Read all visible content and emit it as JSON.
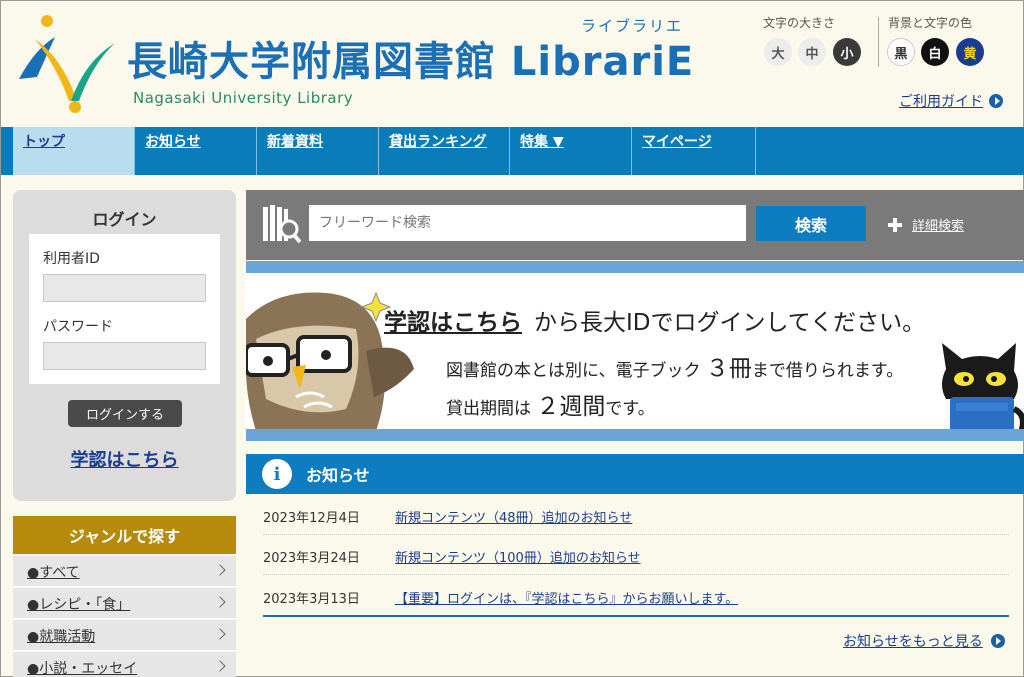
{
  "header": {
    "title": "長崎大学附属図書館 LibrariE",
    "ruby": "ライブラリエ",
    "subtitle": "Nagasaki University Library",
    "font_size_label": "文字の大きさ",
    "font_sizes": [
      "大",
      "中",
      "小"
    ],
    "color_label": "背景と文字の色",
    "colors": [
      "黒",
      "白",
      "黄"
    ],
    "guide_link": "ご利用ガイド"
  },
  "nav": {
    "items": [
      "トップ",
      "お知らせ",
      "新着資料",
      "貸出ランキング",
      "特集 ▼",
      "マイページ"
    ]
  },
  "login": {
    "title": "ログイン",
    "user_id_label": "利用者ID",
    "password_label": "パスワード",
    "button": "ログインする",
    "gakunin_link": "学認はこちら"
  },
  "genre": {
    "title": "ジャンルで探す",
    "items": [
      "●すべて",
      "●レシピ・「食」",
      "●就職活動",
      "●小説・エッセイ"
    ]
  },
  "search": {
    "placeholder": "フリーワード検索",
    "button": "検索",
    "advanced": "詳細検索"
  },
  "banner": {
    "link": "学認はこちら",
    "line1": "から長大IDでログインしてください。",
    "line2_a": "図書館の本とは別に、電子ブック",
    "line2_num": "３冊",
    "line2_b": "まで借りられます。",
    "line3_a": "貸出期間は",
    "line3_num": "２週間",
    "line3_b": "です。"
  },
  "news": {
    "title": "お知らせ",
    "items": [
      {
        "date": "2023年12月4日",
        "text": "新規コンテンツ（48冊）追加のお知らせ"
      },
      {
        "date": "2023年3月24日",
        "text": "新規コンテンツ（100冊）追加のお知らせ"
      },
      {
        "date": "2023年3月13日",
        "text": "【重要】ログインは、『学認はこちら』からお願いします。"
      }
    ],
    "more": "お知らせをもっと見る"
  },
  "colors": {
    "nav_blue": "#0b7cba",
    "title_blue": "#1a6fb5",
    "genre_gold": "#b68a0a",
    "background": "#fbf8ec"
  }
}
